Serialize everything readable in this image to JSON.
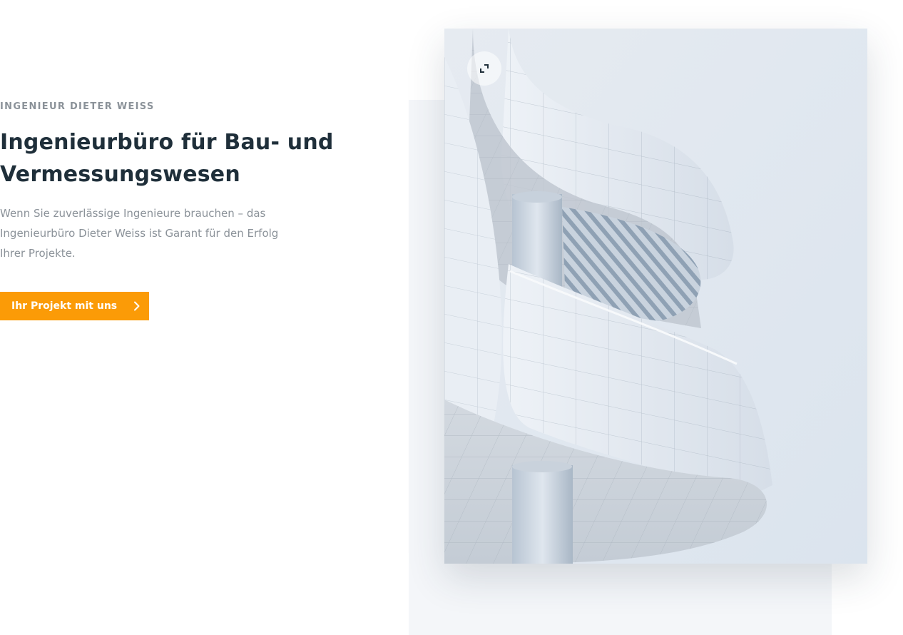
{
  "hero": {
    "eyebrow": "INGENIEUR DIETER WEISS",
    "title_line1": "Ingenieurbüro für Bau- und",
    "title_line2": "Vermessungswesen",
    "lead": "Wenn Sie zuverlässige Ingenieure brauchen – das Ingenieurbüro Dieter Weiss ist Garant für den Erfolg Ihrer Projekte.",
    "cta_label": "Ihr Projekt mit uns",
    "cta_icon": "chevron-right-icon"
  },
  "media": {
    "expand_icon": "expand-icon",
    "image_subject": "architecture-photo"
  },
  "colors": {
    "accent": "#fb9b07",
    "heading": "#1f2f3a",
    "muted": "#8b9299",
    "backdrop": "#f4f6f9"
  }
}
